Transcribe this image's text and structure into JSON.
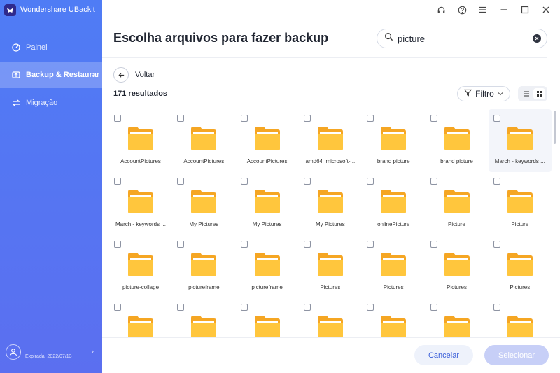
{
  "app": {
    "name": "Wondershare UBackit"
  },
  "sidebar": {
    "items": [
      {
        "label": "Painel",
        "icon": "dashboard-icon"
      },
      {
        "label": "Backup & Restaurar",
        "icon": "backup-icon"
      },
      {
        "label": "Migração",
        "icon": "migration-icon"
      }
    ],
    "account": {
      "expiry": "Expirada: 2022/07/13"
    }
  },
  "main": {
    "title": "Escolha arquivos para fazer backup",
    "search": {
      "value": "picture"
    },
    "back_label": "Voltar",
    "results_count": "171 resultados",
    "filter_label": "Filtro"
  },
  "folders": [
    "AccountPictures",
    "AccountPictures",
    "AccountPictures",
    "amd64_microsoft-...",
    "brand picture",
    "brand picture",
    "March - keywords ...",
    "March - keywords ...",
    "My Pictures",
    "My Pictures",
    "My Pictures",
    "onlinePicture",
    "Picture",
    "Picture",
    "picture-collage",
    "pictureframe",
    "pictureframe",
    "Pictures",
    "Pictures",
    "Pictures",
    "Pictures",
    "",
    "",
    "",
    "",
    "",
    "",
    ""
  ],
  "footer": {
    "cancel_label": "Cancelar",
    "select_label": "Selecionar"
  },
  "colors": {
    "accent": "#4f7cf5",
    "folder": "#ffc63d",
    "folder_dark": "#f5a623"
  }
}
